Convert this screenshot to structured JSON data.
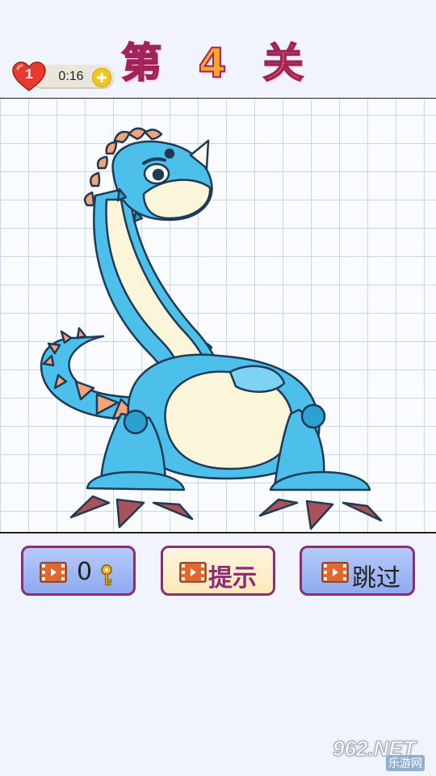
{
  "header": {
    "level_title": "第 4 关",
    "lives": "1",
    "timer": "0:16"
  },
  "buttons": {
    "keys_count": "0",
    "hint_label": "提示",
    "skip_label": "跳过"
  },
  "watermark": {
    "text": "962.NET",
    "sub": "乐游网"
  },
  "colors": {
    "title_fill": "#f6a82a",
    "title_outline": "#a0245a",
    "dino_body": "#4cbfea",
    "dino_belly": "#fbf6da",
    "dino_spikes": "#f6a37a",
    "button_border": "#8d2d7a"
  },
  "icons": [
    "heart-icon",
    "plus-icon",
    "video-icon",
    "key-icon"
  ]
}
